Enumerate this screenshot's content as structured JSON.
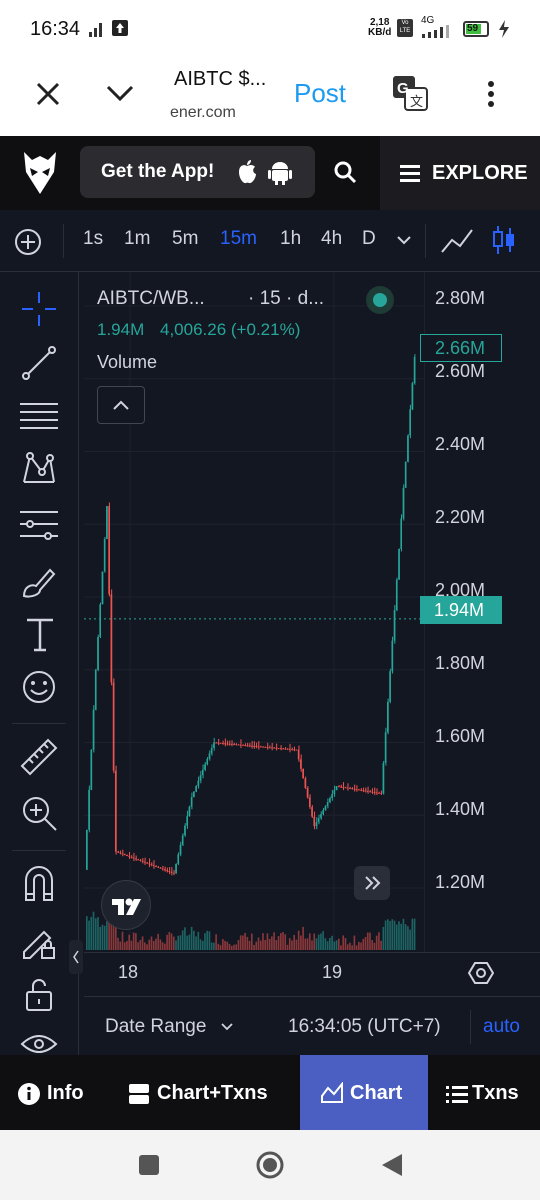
{
  "status_bar": {
    "time": "16:34",
    "speed_value": "2,18",
    "speed_unit": "KB/d",
    "volte": "Vo LTE",
    "network": "4G",
    "battery": "59"
  },
  "browser": {
    "title": "AIBTC $...",
    "url": "ener.com",
    "post_label": "Post"
  },
  "site_header": {
    "get_app_label": "Get the App!",
    "explore_label": "EXPLORE"
  },
  "toolbar": {
    "timeframes": [
      "1s",
      "1m",
      "5m",
      "15m",
      "1h",
      "4h",
      "D"
    ],
    "active_timeframe": "15m"
  },
  "legend": {
    "symbol": "AIBTC/WB...",
    "interval": "· 15 · d...",
    "price": "1.94M",
    "change": "4,006.26 (+0.21%)",
    "volume_label": "Volume"
  },
  "price_axis": {
    "ticks": [
      "2.80M",
      "2.60M",
      "2.40M",
      "2.20M",
      "2.00M",
      "1.80M",
      "1.60M",
      "1.40M",
      "1.20M"
    ],
    "last_price_label": "2.66M",
    "current_price_label": "1.94M"
  },
  "time_axis": {
    "ticks": [
      "18",
      "19"
    ]
  },
  "chart_footer": {
    "date_range_label": "Date Range",
    "clock": "16:34:05 (UTC+7)",
    "auto_label": "auto"
  },
  "bottom_tabs": {
    "info": "Info",
    "chart_txns": "Chart+Txns",
    "chart": "Chart",
    "txns": "Txns"
  },
  "colors": {
    "up": "#26a69a",
    "down": "#ef5350",
    "bg": "#131722",
    "accent": "#2962ff",
    "active_tab": "#4a5fc1"
  },
  "chart_data": {
    "type": "candlestick",
    "ylim": [
      1200000,
      2800000
    ],
    "price_segments": [
      {
        "from_index": 0,
        "to_index": 5,
        "start": 1250000,
        "end": 1800000,
        "direction": "up"
      },
      {
        "from_index": 5,
        "to_index": 10,
        "start": 1800000,
        "end": 2250000,
        "direction": "up"
      },
      {
        "from_index": 10,
        "to_index": 14,
        "start": 2250000,
        "end": 1280000,
        "direction": "down"
      },
      {
        "from_index": 14,
        "to_index": 40,
        "start": 1300000,
        "end": 1240000,
        "direction": "flat"
      },
      {
        "from_index": 40,
        "to_index": 48,
        "start": 1240000,
        "end": 1450000,
        "direction": "up"
      },
      {
        "from_index": 48,
        "to_index": 58,
        "start": 1450000,
        "end": 1600000,
        "direction": "up"
      },
      {
        "from_index": 58,
        "to_index": 95,
        "start": 1600000,
        "end": 1580000,
        "direction": "flat"
      },
      {
        "from_index": 95,
        "to_index": 103,
        "start": 1580000,
        "end": 1370000,
        "direction": "down"
      },
      {
        "from_index": 103,
        "to_index": 113,
        "start": 1370000,
        "end": 1480000,
        "direction": "up"
      },
      {
        "from_index": 113,
        "to_index": 133,
        "start": 1480000,
        "end": 1460000,
        "direction": "flat"
      },
      {
        "from_index": 133,
        "to_index": 143,
        "start": 1460000,
        "end": 2300000,
        "direction": "up"
      },
      {
        "from_index": 143,
        "to_index": 148,
        "start": 2300000,
        "end": 2660000,
        "direction": "up"
      }
    ],
    "last_price": 2660000,
    "current_line": 1940000
  }
}
